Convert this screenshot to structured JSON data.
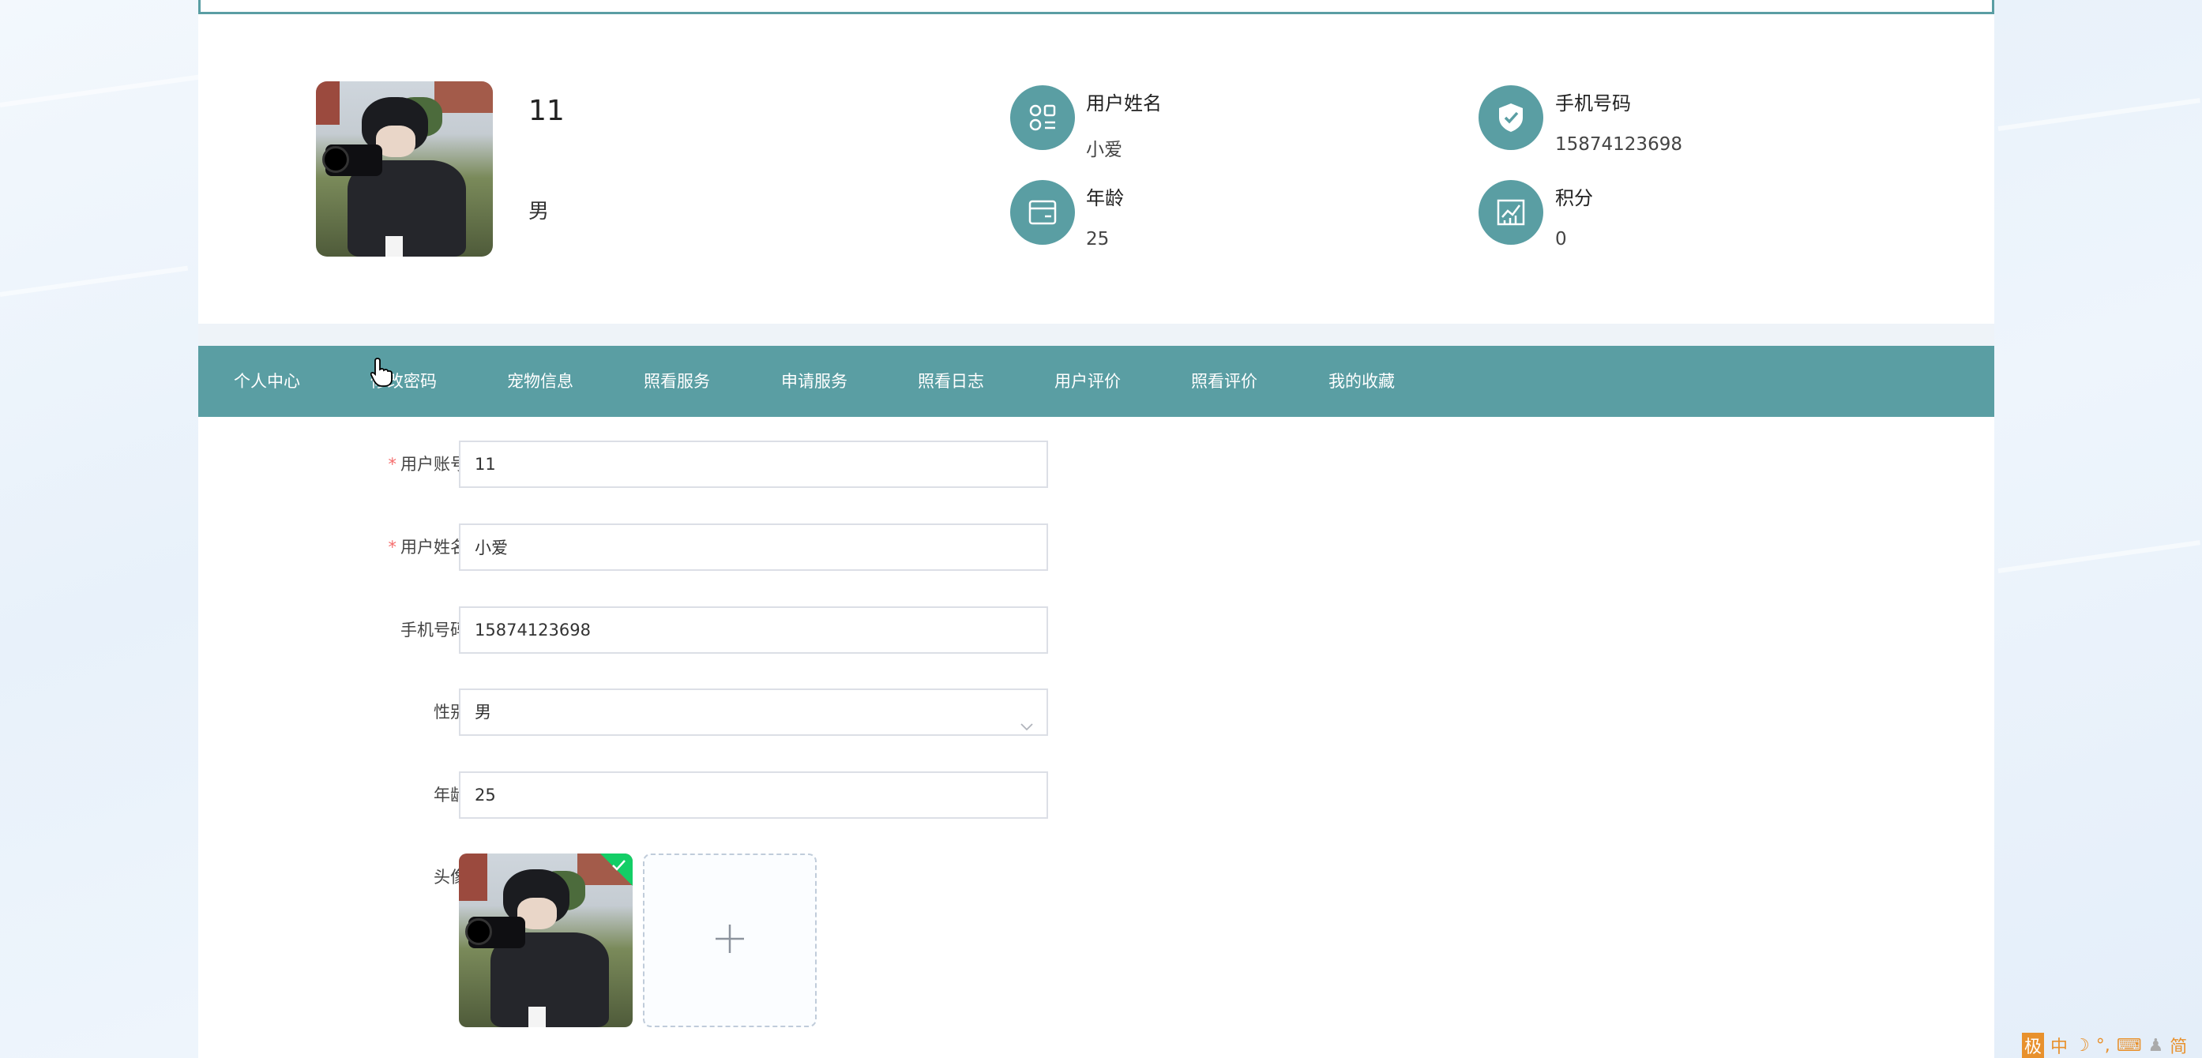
{
  "profile": {
    "username": "11",
    "gender": "男",
    "info": [
      {
        "label": "用户姓名",
        "value": "小爱",
        "icon": "user-grid-icon"
      },
      {
        "label": "手机号码",
        "value": "15874123698",
        "icon": "shield-check-icon"
      },
      {
        "label": "年龄",
        "value": "25",
        "icon": "card-icon"
      },
      {
        "label": "积分",
        "value": "0",
        "icon": "chart-icon"
      }
    ]
  },
  "nav": {
    "items": [
      {
        "label": "个人中心"
      },
      {
        "label": "修改密码"
      },
      {
        "label": "宠物信息"
      },
      {
        "label": "照看服务"
      },
      {
        "label": "申请服务"
      },
      {
        "label": "照看日志"
      },
      {
        "label": "用户评价"
      },
      {
        "label": "照看评价"
      },
      {
        "label": "我的收藏"
      }
    ]
  },
  "form": {
    "account_label": "用户账号",
    "account_value": "11",
    "name_label": "用户姓名",
    "name_value": "小爱",
    "phone_label": "手机号码",
    "phone_value": "15874123698",
    "gender_label": "性别",
    "gender_value": "男",
    "age_label": "年龄",
    "age_value": "25",
    "avatar_label": "头像",
    "required_mark": "*"
  },
  "tray": {
    "items": [
      "极",
      "中",
      "☽",
      "°,",
      "⌨",
      "♟",
      "简"
    ]
  },
  "colors": {
    "accent": "#5a9ea3",
    "required": "#f56c6c",
    "success_badge": "#13ce66"
  }
}
